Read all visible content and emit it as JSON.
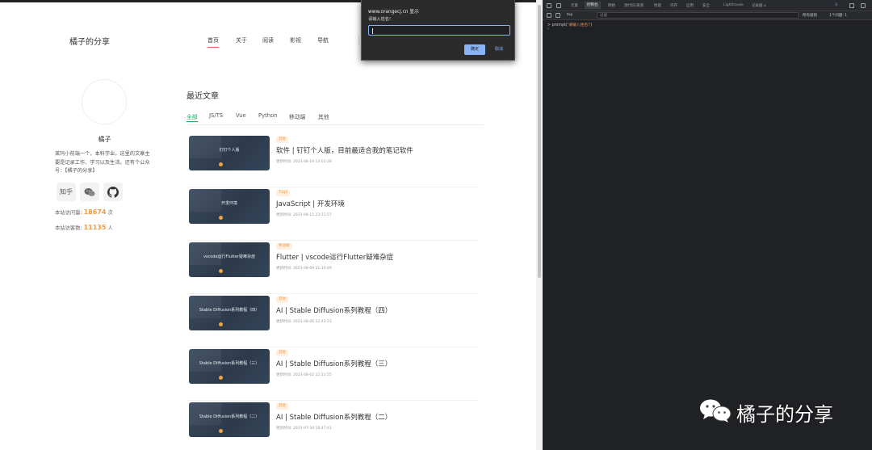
{
  "site": {
    "logo": "橘子的分享",
    "nav": [
      "首页",
      "关于",
      "阅读",
      "影视",
      "导航"
    ],
    "nav_active": 0
  },
  "profile": {
    "name": "橘子",
    "bio": "莱玛小前端一个，本科学业。这里的文章主要是记录工作、学习以及生活。还有个公众号：【橘子的分享】",
    "social": [
      "知乎",
      "wechat-icon",
      "github-icon"
    ],
    "visits_label": "本站访问量:",
    "visits_value": "18674",
    "visits_unit": "次",
    "visitors_label": "本站访客数:",
    "visitors_value": "11135",
    "visitors_unit": "人"
  },
  "main": {
    "section_title": "最近文章",
    "tabs": [
      "全部",
      "JS/TS",
      "Vue",
      "Python",
      "移动端",
      "其他"
    ],
    "tab_active": 0,
    "articles": [
      {
        "thumb": "钉钉个人版",
        "badge": "其他",
        "title": "软件 | 钉钉个人版，目前最适合我的笔记软件",
        "time": "更新时间: 2023-08-19 13:03:28"
      },
      {
        "thumb": "开发环境",
        "badge": "TS/JS",
        "title": "JavaScript | 开发环境",
        "time": "更新时间: 2023-08-15 23:31:57"
      },
      {
        "thumb": "vscode运行Flutter疑难杂症",
        "badge": "移动端",
        "title": "Flutter | vscode运行Flutter疑难杂症",
        "time": "更新时间: 2023-08-09 21:10:49"
      },
      {
        "thumb": "Stable Diffusion系列教程（四）",
        "badge": "其他",
        "title": "AI | Stable Diffusion系列教程（四）",
        "time": "更新时间: 2023-08-06 12:43:23"
      },
      {
        "thumb": "Stable Diffusion系列教程（三）",
        "badge": "其他",
        "title": "AI | Stable Diffusion系列教程（三）",
        "time": "更新时间: 2023-08-02 22:21:55"
      },
      {
        "thumb": "Stable Diffusion系列教程（二）",
        "badge": "其他",
        "title": "AI | Stable Diffusion系列教程（二）",
        "time": "更新时间: 2023-07-30 18:47:41"
      }
    ]
  },
  "dialog": {
    "origin": "www.orangecj.cn 显示",
    "message": "请输入姓名!",
    "input_value": "",
    "ok": "确定",
    "cancel": "取消"
  },
  "devtools": {
    "tabs": [
      "元素",
      "控制台",
      "网络",
      "源代码/来源",
      "性能",
      "内存",
      "应用",
      "安全",
      "Lighthouse",
      "记录器 ⌂"
    ],
    "active_tab": 1,
    "badge": "3",
    "context": "top",
    "filter_placeholder": "过滤",
    "levels": "所有级别",
    "issues": "1个问题: 1",
    "console_fn": "prompt(",
    "console_arg": "'请输入姓名!'",
    "console_close": ")",
    "prompt_caret": ">"
  },
  "watermark": {
    "text": "橘子的分享"
  },
  "colors": {
    "accent_green": "#23a55a",
    "accent_orange": "#f29a3f",
    "nav_underline": "#e65a4a",
    "devtools_bg": "#202124"
  }
}
